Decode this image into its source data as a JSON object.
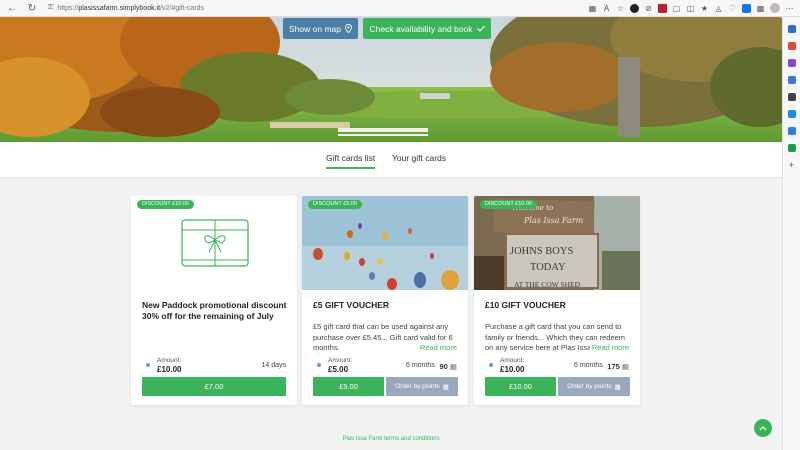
{
  "browser": {
    "url_prefix": "https://",
    "url": "plasissafarm.simplybook.it",
    "url_path": "/v2/#gift-cards"
  },
  "hero": {
    "map_button": "Show on map",
    "book_button": "Check availability and book"
  },
  "tabs": [
    {
      "label": "Gift cards list",
      "active": true
    },
    {
      "label": "Your gift cards",
      "active": false
    }
  ],
  "cards": [
    {
      "badge": "DISCOUNT  £10.00",
      "title": "New Paddock promotional discount 30% off for the remaining of July",
      "description": "",
      "read_more": "",
      "amount_label": "Amount:",
      "amount": "£10.00",
      "duration": "14 days",
      "points": "",
      "price_button": "£7.00",
      "points_button": ""
    },
    {
      "badge": "DISCOUNT  £5.00",
      "title": "£5 GIFT VOUCHER",
      "description": "£5 gift card that can be used against any purchase over £5.45... Gift card valid for 6 months.",
      "read_more": "Read more",
      "amount_label": "Amount:",
      "amount": "£5.00",
      "duration": "6 months",
      "points": "90",
      "price_button": "£5.00",
      "points_button": "Order by points"
    },
    {
      "badge": "DISCOUNT  £10.00",
      "title": "£10 GIFT VOUCHER",
      "description": "Purchase a gift card that you can send to family or friends... Which they can redeem on any service here at Plas Issa",
      "read_more": "Read more",
      "amount_label": "Amount:",
      "amount": "£10.00",
      "duration": "6 months",
      "points": "175",
      "price_button": "£10.00",
      "points_button": "Order by points"
    }
  ],
  "sign": {
    "welcome": "Welcome to",
    "farm": "Plas Issa Farm",
    "johns_boys": "JOHNS BOYS",
    "today": "TODAY",
    "at": "AT THE COW SHED"
  },
  "footer": {
    "terms_link": "Plas Issa Farm terms and conditions"
  },
  "colors": {
    "accent": "#3bb35a",
    "map_button": "#4d7ea8",
    "points_button": "#9aa8bd"
  }
}
